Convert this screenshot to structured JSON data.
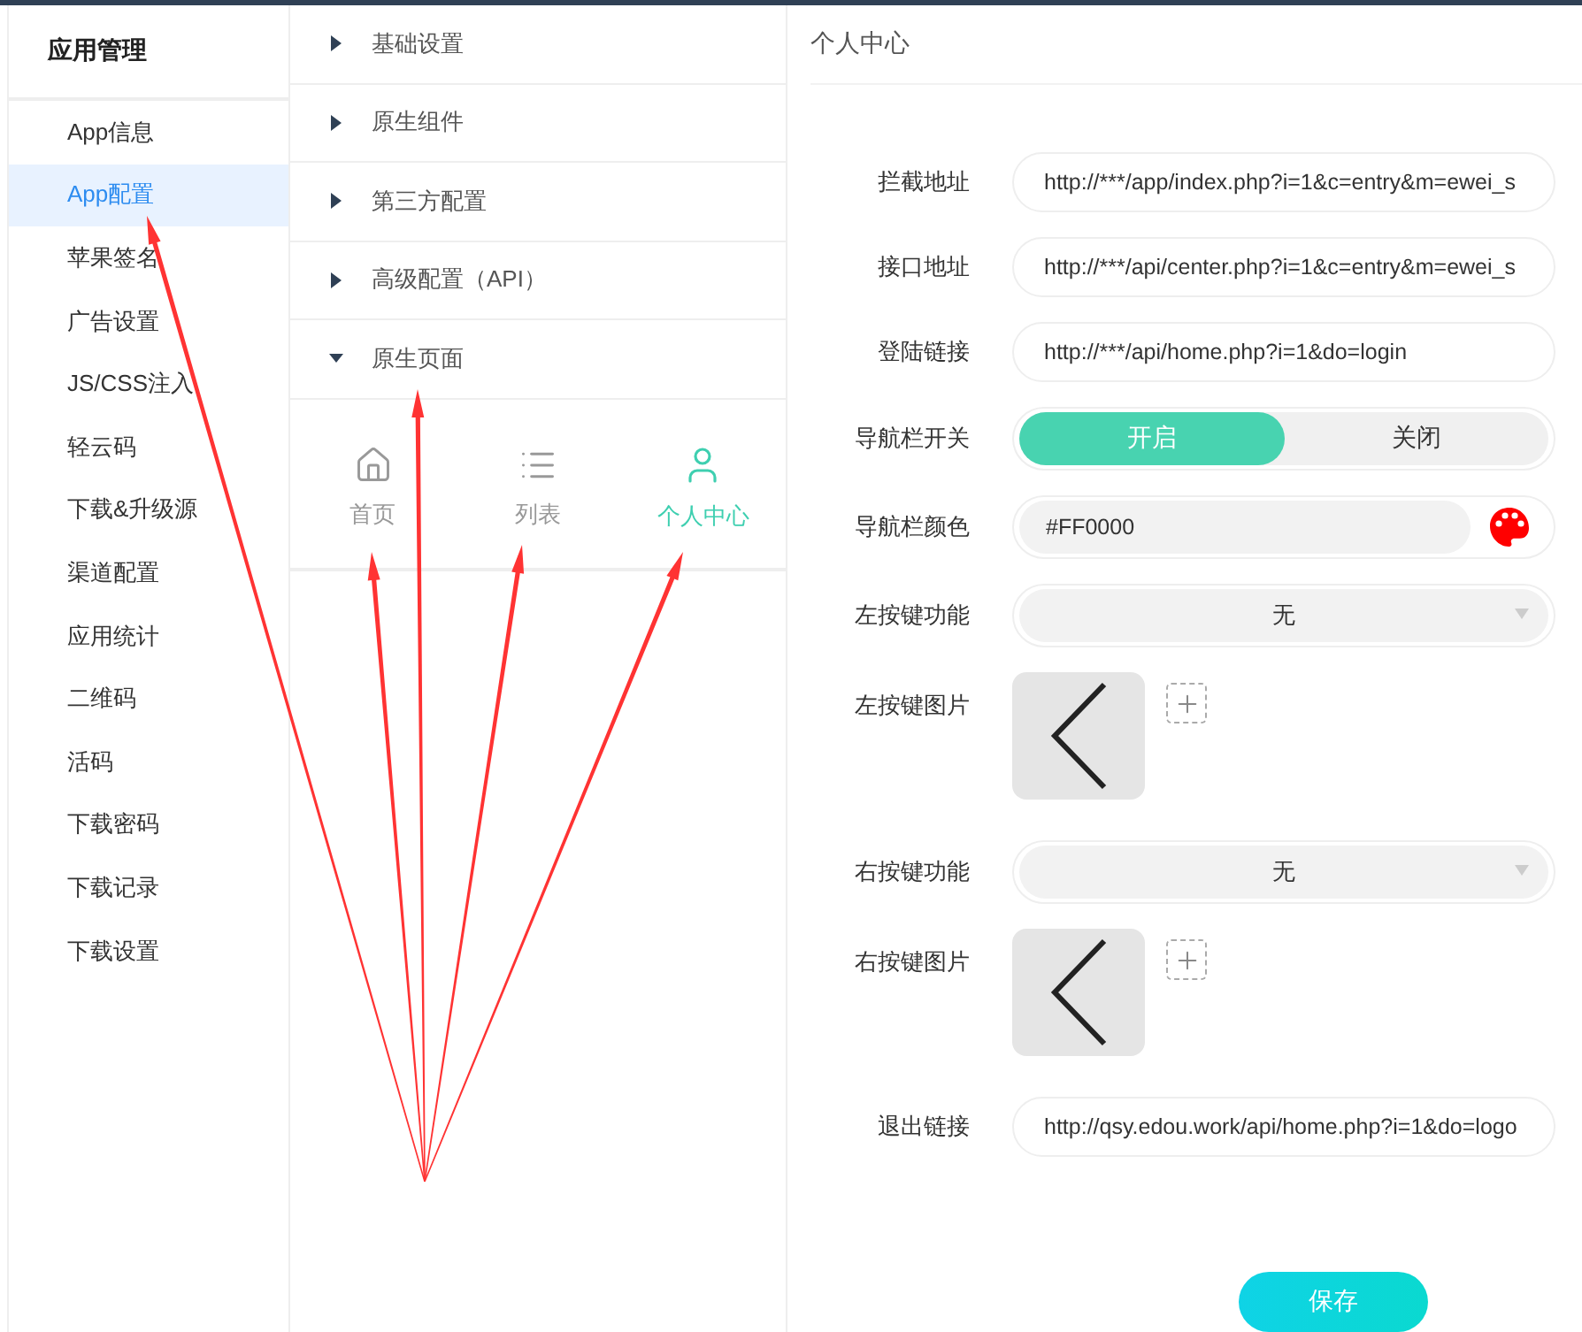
{
  "sidebar": {
    "title": "应用管理",
    "items": [
      {
        "label": "App信息",
        "selected": false
      },
      {
        "label": "App配置",
        "selected": true
      },
      {
        "label": "苹果签名",
        "selected": false
      },
      {
        "label": "广告设置",
        "selected": false
      },
      {
        "label": "JS/CSS注入",
        "selected": false
      },
      {
        "label": "轻云码",
        "selected": false
      },
      {
        "label": "下载&升级源",
        "selected": false
      },
      {
        "label": "渠道配置",
        "selected": false
      },
      {
        "label": "应用统计",
        "selected": false
      },
      {
        "label": "二维码",
        "selected": false
      },
      {
        "label": "活码",
        "selected": false
      },
      {
        "label": "下载密码",
        "selected": false
      },
      {
        "label": "下载记录",
        "selected": false
      },
      {
        "label": "下载设置",
        "selected": false
      }
    ]
  },
  "sections": [
    {
      "label": "基础设置",
      "expanded": false
    },
    {
      "label": "原生组件",
      "expanded": false
    },
    {
      "label": "第三方配置",
      "expanded": false
    },
    {
      "label": "高级配置（API）",
      "expanded": false
    },
    {
      "label": "原生页面",
      "expanded": true
    }
  ],
  "page_tabs": [
    {
      "kind": "home",
      "label": "首页",
      "selected": false
    },
    {
      "kind": "list",
      "label": "列表",
      "selected": false
    },
    {
      "kind": "user",
      "label": "个人中心",
      "selected": true
    }
  ],
  "form": {
    "title": "个人中心",
    "fields": [
      {
        "kind": "text",
        "label": "拦截地址",
        "value": "http://***/app/index.php?i=1&c=entry&m=ewei_s"
      },
      {
        "kind": "text",
        "label": "接口地址",
        "value": "http://***/api/center.php?i=1&c=entry&m=ewei_s"
      },
      {
        "kind": "text",
        "label": "登陆链接",
        "value": "http://***/api/home.php?i=1&do=login"
      },
      {
        "kind": "toggle",
        "label": "导航栏开关",
        "options": [
          {
            "label": "开启",
            "selected": true
          },
          {
            "label": "关闭",
            "selected": false
          }
        ]
      },
      {
        "kind": "color",
        "label": "导航栏颜色",
        "value": "#FF0000"
      },
      {
        "kind": "select",
        "label": "左按键功能",
        "value": "无"
      },
      {
        "kind": "image",
        "label": "左按键图片"
      },
      {
        "kind": "select",
        "label": "右按键功能",
        "value": "无"
      },
      {
        "kind": "image",
        "label": "右按键图片"
      },
      {
        "kind": "text",
        "label": "退出链接",
        "value": "http://qsy.edou.work/api/home.php?i=1&do=logo"
      }
    ],
    "save": "保存"
  }
}
